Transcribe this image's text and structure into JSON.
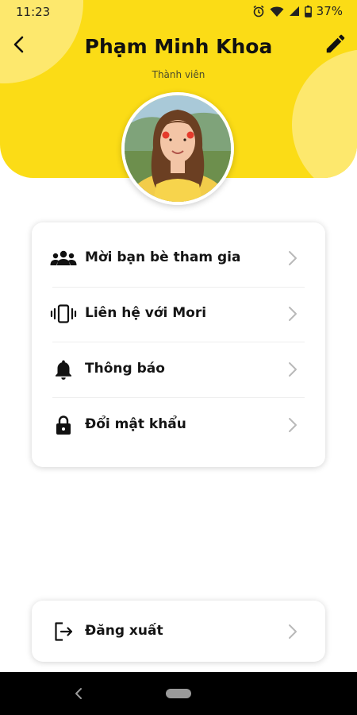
{
  "status": {
    "time": "11:23",
    "battery": "37%"
  },
  "profile": {
    "name": "Phạm Minh Khoa",
    "role": "Thành viên"
  },
  "menu": [
    {
      "label": "Mời bạn bè tham gia",
      "icon": "group-icon"
    },
    {
      "label": "Liên hệ với Mori",
      "icon": "phone-vibrate-icon"
    },
    {
      "label": "Thông báo",
      "icon": "bell-icon"
    },
    {
      "label": "Đổi mật khẩu",
      "icon": "lock-icon"
    }
  ],
  "logout": {
    "label": "Đăng xuất",
    "icon": "logout-icon"
  },
  "colors": {
    "accent": "#fbdc16",
    "accent_light": "#fde86d"
  }
}
